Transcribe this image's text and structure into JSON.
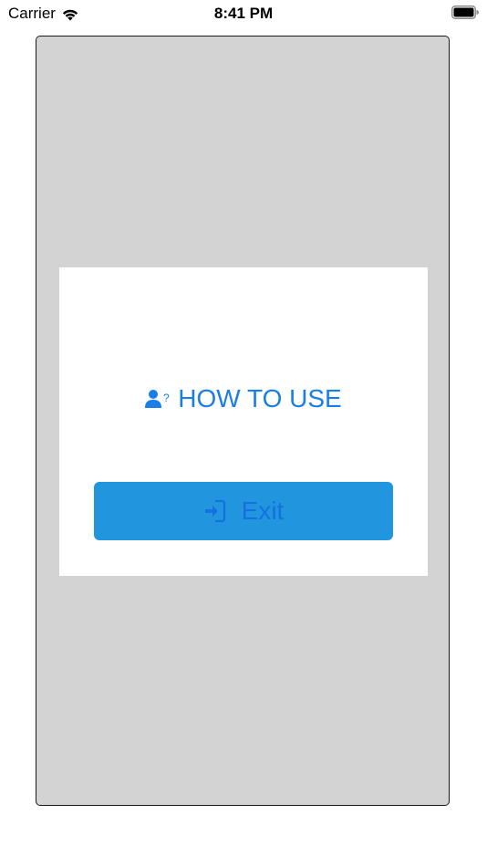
{
  "status_bar": {
    "carrier": "Carrier",
    "time": "8:41 PM",
    "wifi_icon": "wifi-icon",
    "battery_icon": "battery-icon"
  },
  "card": {
    "how_to_use_label": "HOW TO USE",
    "how_to_use_icon": "user-question-icon",
    "exit_label": "Exit",
    "exit_icon": "sign-in-icon"
  },
  "colors": {
    "frame_bg": "#d3d3d3",
    "card_bg": "#ffffff",
    "link_blue": "#1a7ee8",
    "button_bg": "#2196de",
    "button_text": "#1570e0"
  }
}
